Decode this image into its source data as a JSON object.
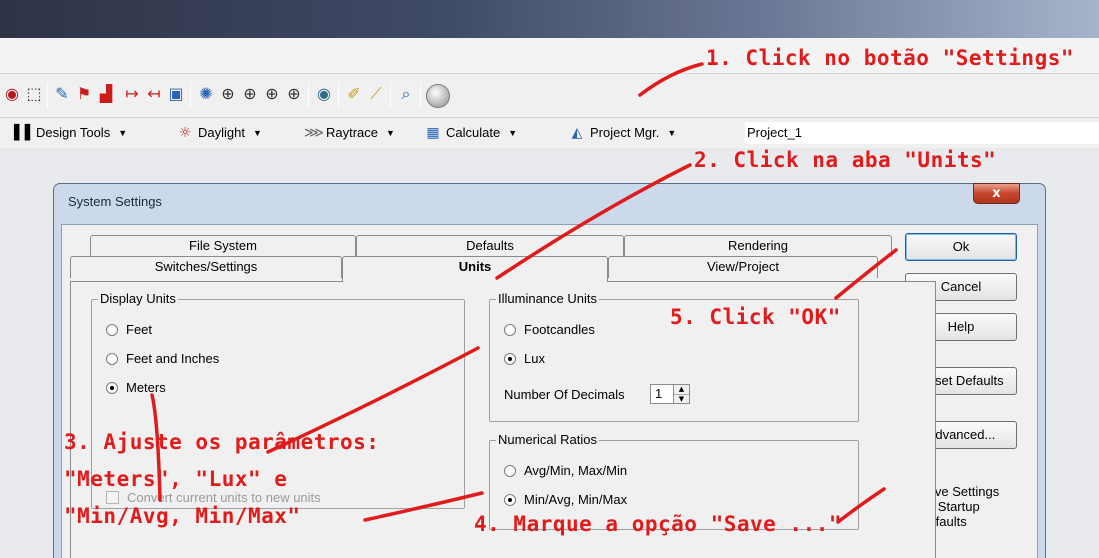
{
  "toolbar2": {
    "design_tools": "Design Tools",
    "daylight": "Daylight",
    "raytrace": "Raytrace",
    "calculate": "Calculate",
    "project_mgr": "Project Mgr.",
    "project_name": "Project_1"
  },
  "dialog": {
    "title": "System Settings",
    "close": "x",
    "tabs_back": [
      "File System",
      "Defaults",
      "Rendering"
    ],
    "tabs_front": [
      "Switches/Settings",
      "Units",
      "View/Project"
    ],
    "active_tab": "Units",
    "display_units": {
      "title": "Display Units",
      "options": [
        "Feet",
        "Feet and Inches",
        "Meters"
      ],
      "selected": "Meters",
      "convert_label": "Convert current units to new units"
    },
    "illuminance_units": {
      "title": "Illuminance Units",
      "options": [
        "Footcandles",
        "Lux"
      ],
      "selected": "Lux",
      "decimals_label": "Number Of Decimals",
      "decimals_value": "1"
    },
    "numerical_ratios": {
      "title": "Numerical Ratios",
      "options": [
        "Avg/Min, Max/Min",
        "Min/Avg, Min/Max"
      ],
      "selected": "Min/Avg, Min/Max"
    },
    "buttons": {
      "ok": "Ok",
      "cancel": "Cancel",
      "help": "Help",
      "reset": "Reset Defaults",
      "advanced": "Advanced..."
    },
    "save_settings": {
      "line1": "Save Settings",
      "line2": "As Startup",
      "line3": "Defaults",
      "checked": true
    }
  },
  "annotations": {
    "step1": "1. Click no botão \"Settings\"",
    "step2": "2. Click na aba \"Units\"",
    "step3_line1": "3. Ajuste os parâmetros:",
    "step3_line2": "\"Meters\", \"Lux\" e",
    "step3_line3": "\"Min/Avg, Min/Max\"",
    "step4": "4. Marque a opção \"Save ...\"",
    "step5": "5. Click \"OK\"",
    "color": "#e01b1b"
  }
}
